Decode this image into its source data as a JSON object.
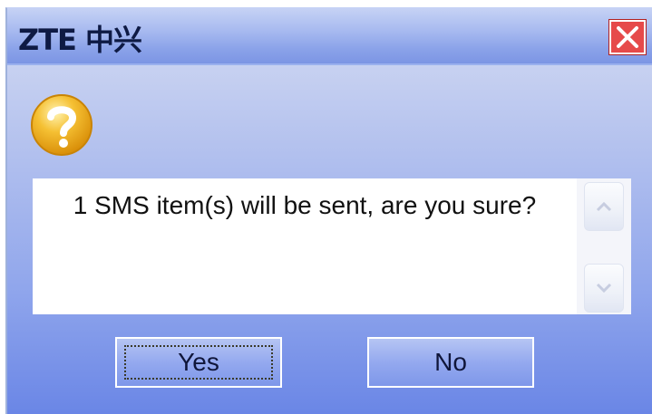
{
  "window": {
    "logo_text": "ZTE 中兴",
    "close_icon": "close-icon"
  },
  "dialog": {
    "icon": "question-icon",
    "message": "1 SMS item(s) will be sent, are you sure?",
    "scroll_up_icon": "chevron-up-icon",
    "scroll_down_icon": "chevron-down-icon"
  },
  "buttons": {
    "yes_label": "Yes",
    "no_label": "No"
  },
  "colors": {
    "title_gradient": "#a9bbf0",
    "body_bottom": "#6a86e6",
    "close_red": "#e64a4a",
    "icon_gold": "#f2b21c"
  }
}
